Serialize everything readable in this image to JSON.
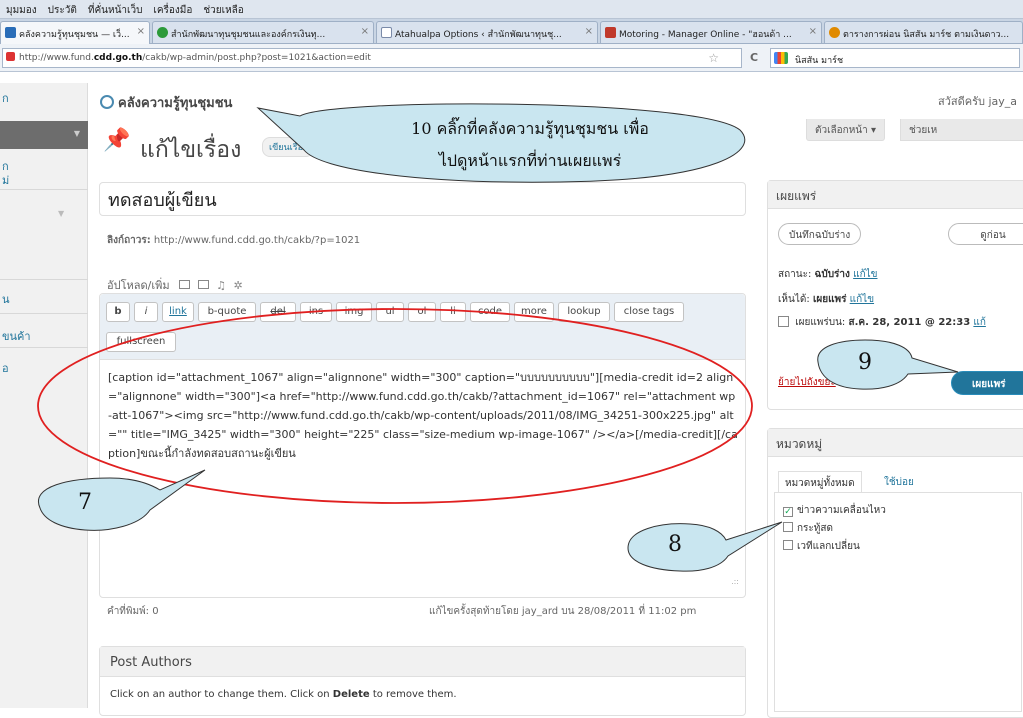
{
  "browser": {
    "menu": [
      "มุมมอง",
      "ประวัติ",
      "ที่คั่นหน้าเว็บ",
      "เครื่องมือ",
      "ช่วยเหลือ"
    ],
    "tabs": [
      {
        "label": "คลังความรู้ทุนชุมชน — เว็...",
        "active": true,
        "icon_color": "#2a6db8"
      },
      {
        "label": "สำนักพัฒนาทุนชุมชนและองค์กรเงินทุ...",
        "active": false,
        "icon_color": "#2c9a3a"
      },
      {
        "label": "Atahualpa Options ‹ สำนักพัฒนาทุนชุ...",
        "active": false,
        "icon_color": "#7a8aa8"
      },
      {
        "label": "Motoring - Manager Online - \"ฮอนด้า ...",
        "active": false,
        "icon_color": "#c0392b"
      },
      {
        "label": "ตารางการผ่อน นิสสัน มาร์ช ตามเงินดาว...",
        "active": false,
        "icon_color": "#e08a00"
      }
    ],
    "tab_close": "×",
    "url_prefix": "http://www.fund.",
    "url_domain": "cdd.go.th",
    "url_rest": "/cakb/wp-admin/post.php?post=1021&action=edit",
    "search_value": "นิสสัน มาร์ช",
    "star_icon": "☆",
    "reload_icon": "C"
  },
  "sidebar": {
    "items": [
      "ก",
      "",
      "ก",
      "ม่",
      "",
      "",
      "น",
      "ขนค้า",
      "อ"
    ]
  },
  "header": {
    "site_title": "คลังความรู้ทุนชุมชน",
    "howdy": "สวัสดีครับ jay_a",
    "page_title": "แก้ไขเรื่อง",
    "add_new": "เขียนเรื่อง",
    "screen_options": "ตัวเลือกหน้า ▾",
    "help": "ช่วยเห"
  },
  "post": {
    "title": "ทดสอบผู้เขียน",
    "permalink_label": "ลิงก์ถาวร:",
    "permalink_url": "http://www.fund.cdd.go.th/cakb/?p=1021",
    "upload_label": "อัปโหลด/เพิ่ม",
    "quicktags": [
      "b",
      "i",
      "link",
      "b-quote",
      "del",
      "ins",
      "img",
      "ul",
      "ol",
      "li",
      "code",
      "more",
      "lookup",
      "close tags",
      "fullscreen"
    ],
    "content": "[caption id=\"attachment_1067\" align=\"alignnone\" width=\"300\" caption=\"บบบบบบบบบบ\"][media-credit id=2 align=\"alignnone\" width=\"300\"]<a href=\"http://www.fund.cdd.go.th/cakb/?attachment_id=1067\" rel=\"attachment wp-att-1067\"><img src=\"http://www.fund.cdd.go.th/cakb/wp-content/uploads/2011/08/IMG_34251-300x225.jpg\" alt=\"\" title=\"IMG_3425\" width=\"300\" height=\"225\" class=\"size-medium wp-image-1067\" /></a>[/media-credit][/caption]ขณะนี้กำลังทดสอบสถานะผู้เขียน",
    "word_count": "คำที่พิมพ์: 0",
    "last_edit": "แก้ไขครั้งสุดท้ายโดย jay_ard บน 28/08/2011 ที่ 11:02 pm"
  },
  "authors": {
    "title": "Post Authors",
    "hint_pre": "Click on an author to change them. Click on ",
    "hint_bold": "Delete",
    "hint_post": " to remove them."
  },
  "publish": {
    "title": "เผยแพร่",
    "save_draft": "บันทึกฉบับร่าง",
    "preview": "ดูก่อน",
    "status_label": "สถานะ:",
    "status_value": "ฉบับร่าง",
    "visibility_label": "เห็นได้:",
    "visibility_value": "เผยแพร่",
    "schedule_label": "เผยแพร่บน:",
    "schedule_value": "ส.ค. 28, 2011 @ 22:33",
    "edit_link": "แก้ไข",
    "schedule_edit": "แก้",
    "trash": "ย้ายไปถังขยะ",
    "publish_button": "เผยแพร่"
  },
  "categories": {
    "title": "หมวดหมู่",
    "tab_all": "หมวดหมู่ทั้งหมด",
    "tab_popular": "ใช้บ่อย",
    "items": [
      {
        "label": "ข่าวความเคลื่อนไหว",
        "checked": true
      },
      {
        "label": "กระทู้สด",
        "checked": false
      },
      {
        "label": "เวทีแลกเปลี่ยน",
        "checked": false
      }
    ]
  },
  "annotations": {
    "callout_10_line1": "10 คลิ๊กที่คลังความรู้ทุนชุมชน เพื่อ",
    "callout_10_line2": "ไปดูหน้าแรกที่ท่านเผยแพร่",
    "callout_7": "7",
    "callout_8": "8",
    "callout_9": "9",
    "bubble_color": "#c9e6f0",
    "ellipse_color": "#e02020"
  }
}
